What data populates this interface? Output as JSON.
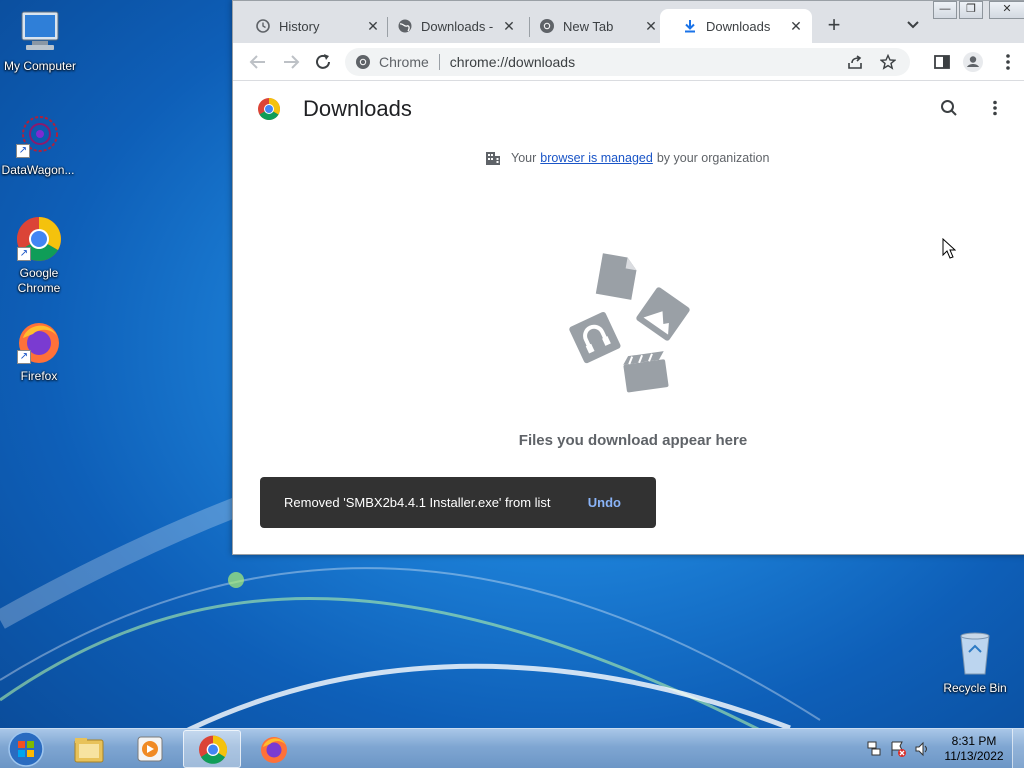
{
  "desktop": {
    "icons": [
      {
        "label": "My Computer"
      },
      {
        "label": "DataWagon..."
      },
      {
        "label": "Google Chrome"
      },
      {
        "label": "Firefox"
      },
      {
        "label": "Recycle Bin"
      }
    ]
  },
  "browser": {
    "tabs": [
      {
        "label": "History",
        "icon": "history-icon"
      },
      {
        "label": "Downloads - S",
        "icon": "globe-icon"
      },
      {
        "label": "New Tab",
        "icon": "chrome-icon"
      },
      {
        "label": "Downloads",
        "icon": "download-icon",
        "active": true
      }
    ],
    "omnibox": {
      "site_label": "Chrome",
      "url": "chrome://downloads"
    }
  },
  "page": {
    "title": "Downloads",
    "managed": {
      "prefix": "Your",
      "link": "browser is managed",
      "suffix": "by your organization"
    },
    "empty_text": "Files you download appear here",
    "toast": {
      "message": "Removed 'SMBX2b4.4.1 Installer.exe' from list",
      "action": "Undo"
    }
  },
  "taskbar": {
    "clock": {
      "time": "8:31 PM",
      "date": "11/13/2022"
    }
  },
  "colors": {
    "accent": "#1a73e8",
    "toast_bg": "#323232",
    "undo": "#8ab4f8"
  }
}
